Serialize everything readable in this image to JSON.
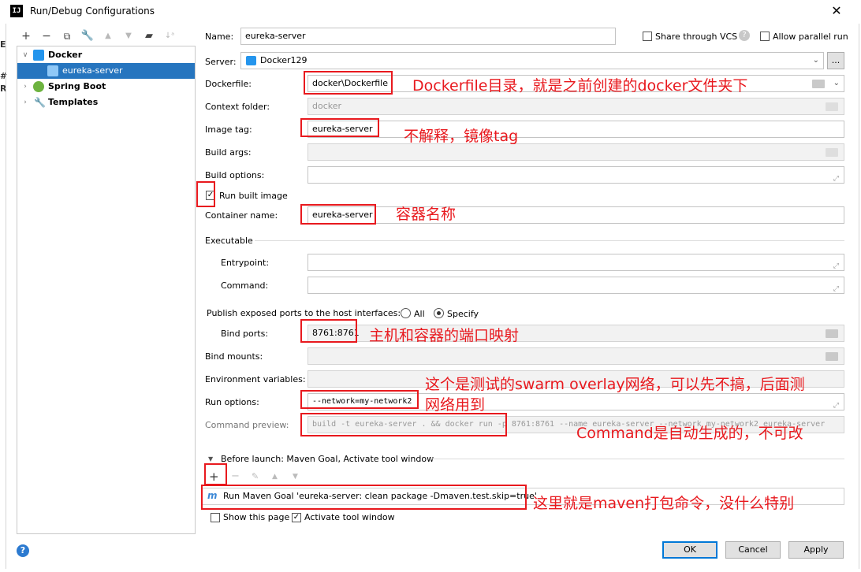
{
  "window": {
    "title": "Run/Debug Configurations",
    "app_icon": "IJ"
  },
  "tree": {
    "items": [
      {
        "label": "Docker",
        "level": 0,
        "expanded": true,
        "icon": "docker-icon"
      },
      {
        "label": "eureka-server",
        "level": 1,
        "selected": true,
        "icon": "docker-icon"
      },
      {
        "label": "Spring Boot",
        "level": 0,
        "expanded": false,
        "icon": "spring-icon"
      },
      {
        "label": "Templates",
        "level": 0,
        "expanded": false,
        "icon": "wrench-icon"
      }
    ]
  },
  "form": {
    "name_label": "Name:",
    "name_value": "eureka-server",
    "share_vcs": "Share through VCS",
    "allow_parallel": "Allow parallel run",
    "server_label": "Server:",
    "server_value": "Docker129",
    "server_more": "...",
    "dockerfile_label": "Dockerfile:",
    "dockerfile_value": "docker\\Dockerfile",
    "context_label": "Context folder:",
    "context_value": "docker",
    "image_tag_label": "Image tag:",
    "image_tag_value": "eureka-server",
    "build_args_label": "Build args:",
    "build_options_label": "Build options:",
    "run_built_image": "Run built image",
    "container_label": "Container name:",
    "container_value": "eureka-server",
    "executable_label": "Executable",
    "entrypoint_label": "Entrypoint:",
    "command_label": "Command:",
    "publish_label": "Publish exposed ports to the host interfaces:",
    "radio_all": "All",
    "radio_specify": "Specify",
    "bind_ports_label": "Bind ports:",
    "bind_ports_value": "8761:8761",
    "bind_mounts_label": "Bind mounts:",
    "env_label": "Environment variables:",
    "run_options_label": "Run options:",
    "run_options_value": "--network=my-network2",
    "preview_label": "Command preview:",
    "preview_value": "build -t eureka-server . && docker run -p 8761:8761 --name eureka-server --network my-network2 eureka-server",
    "before_launch_label": "Before launch: Maven Goal, Activate tool window",
    "maven_goal": "Run Maven Goal 'eureka-server: clean package -Dmaven.test.skip=true'",
    "show_page": "Show this page",
    "activate_tool": "Activate tool window"
  },
  "annotations": {
    "dockerfile": "Dockerfile目录，就是之前创建的docker文件夹下",
    "image_tag": "不解释，镜像tag",
    "container": "容器名称",
    "ports": "主机和容器的端口映射",
    "network_line1": "这个是测试的swarm overlay网络，可以先不搞，后面测",
    "network_line2": "网络用到",
    "command": "Command是自动生成的，不可改",
    "maven": "这里就是maven打包命令，没什么特别"
  },
  "buttons": {
    "ok": "OK",
    "cancel": "Cancel",
    "apply": "Apply",
    "help": "?"
  },
  "colors": {
    "selection": "#2675bf",
    "annotation_red": "#e8191e",
    "default_button": "#0078d7"
  }
}
